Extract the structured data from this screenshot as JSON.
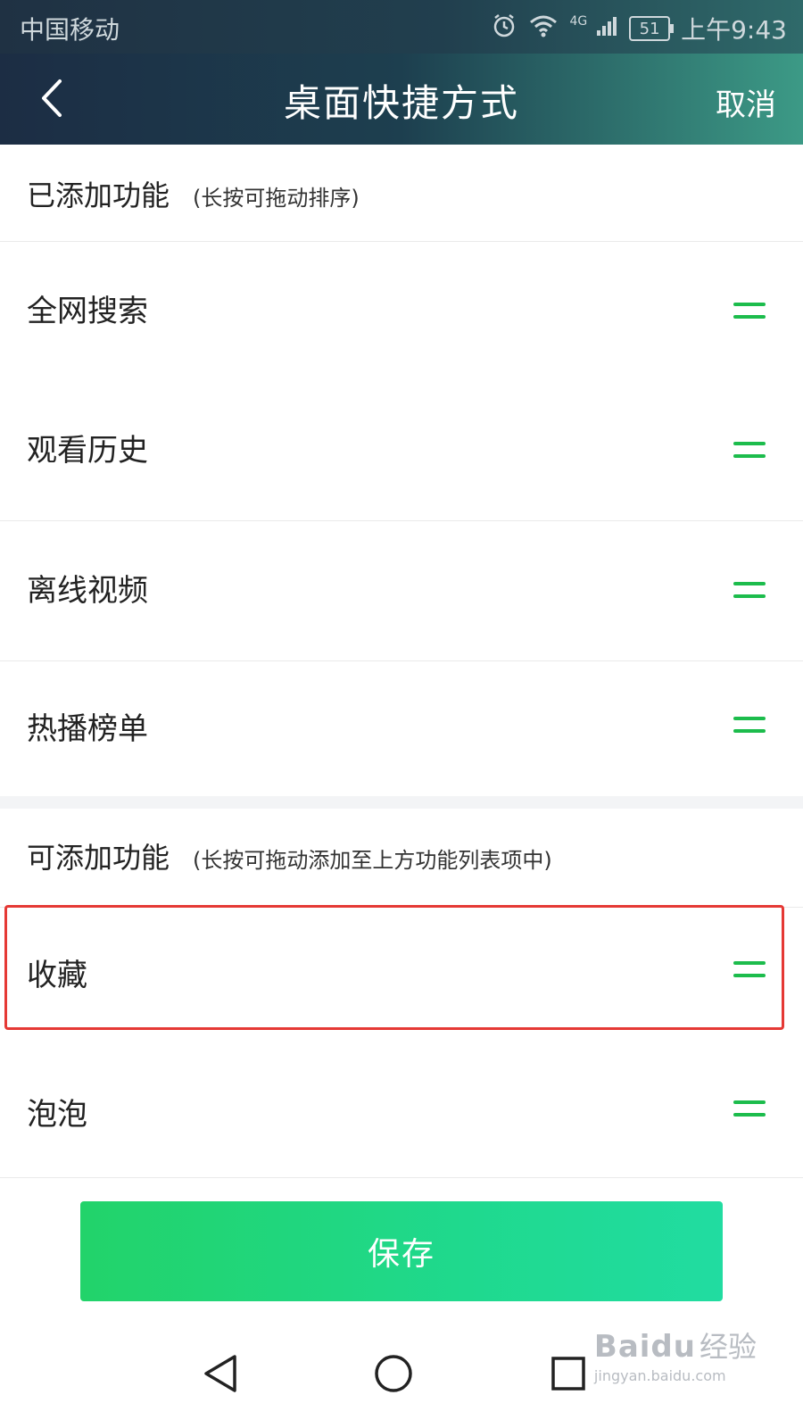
{
  "status_bar": {
    "carrier": "中国移动",
    "network": "4G",
    "battery": "51",
    "time": "上午9:43"
  },
  "titlebar": {
    "title": "桌面快捷方式",
    "cancel_label": "取消"
  },
  "added_section": {
    "heading": "已添加功能",
    "hint": "(长按可拖动排序)",
    "items": [
      {
        "label": "全网搜索"
      },
      {
        "label": "观看历史"
      },
      {
        "label": "离线视频"
      },
      {
        "label": "热播榜单"
      }
    ]
  },
  "available_section": {
    "heading": "可添加功能",
    "hint": "(长按可拖动添加至上方功能列表项中)",
    "items": [
      {
        "label": "收藏"
      },
      {
        "label": "泡泡"
      }
    ]
  },
  "save_label": "保存",
  "watermark": {
    "brand": "Baidu",
    "suffix": "经验",
    "url": "jingyan.baidu.com"
  },
  "colors": {
    "accent_green": "#1cbc4c",
    "highlight_red": "#e53935"
  }
}
